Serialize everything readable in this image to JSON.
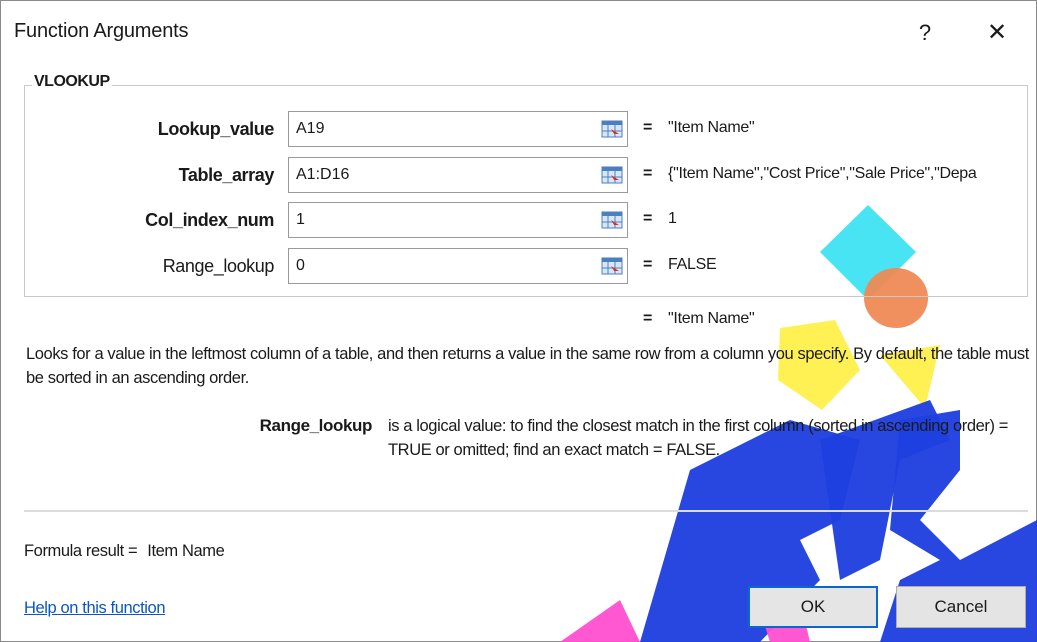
{
  "dialog": {
    "title": "Function Arguments",
    "help_glyph": "?",
    "close_glyph": "✕"
  },
  "function_group": {
    "name": "VLOOKUP",
    "arguments": [
      {
        "label": "Lookup_value",
        "value": "A19",
        "result": "\"Item Name\"",
        "bold": true
      },
      {
        "label": "Table_array",
        "value": "A1:D16",
        "result": "{\"Item Name\",\"Cost Price\",\"Sale Price\",\"Depa",
        "bold": true
      },
      {
        "label": "Col_index_num",
        "value": "1",
        "result": "1",
        "bold": true
      },
      {
        "label": "Range_lookup",
        "value": "0",
        "result": "FALSE",
        "bold": false
      }
    ],
    "equals_sign": "=",
    "picker_icon": "collapse-dialog-icon"
  },
  "overall_result": "\"Item Name\"",
  "description": "Looks for a value in the leftmost column of a table, and then returns a value in the same row from a column you specify. By default, the table must be sorted in an ascending order.",
  "argument_detail": {
    "name": "Range_lookup",
    "text": "is a logical value: to find the closest match in the first column (sorted in ascending order) = TRUE or omitted; find an exact match = FALSE."
  },
  "formula_result": {
    "label": "Formula result =",
    "value": "Item Name"
  },
  "help_link": "Help on this function",
  "buttons": {
    "ok": "OK",
    "cancel": "Cancel"
  },
  "colors": {
    "accent": "#0a66d0",
    "link": "#0b55c4",
    "watermark_blue": "#1f3fe0",
    "watermark_cyan": "#3ee3f2",
    "watermark_orange": "#ef8a55",
    "watermark_yellow": "#fff04a",
    "watermark_pink": "#ff4fd0"
  }
}
